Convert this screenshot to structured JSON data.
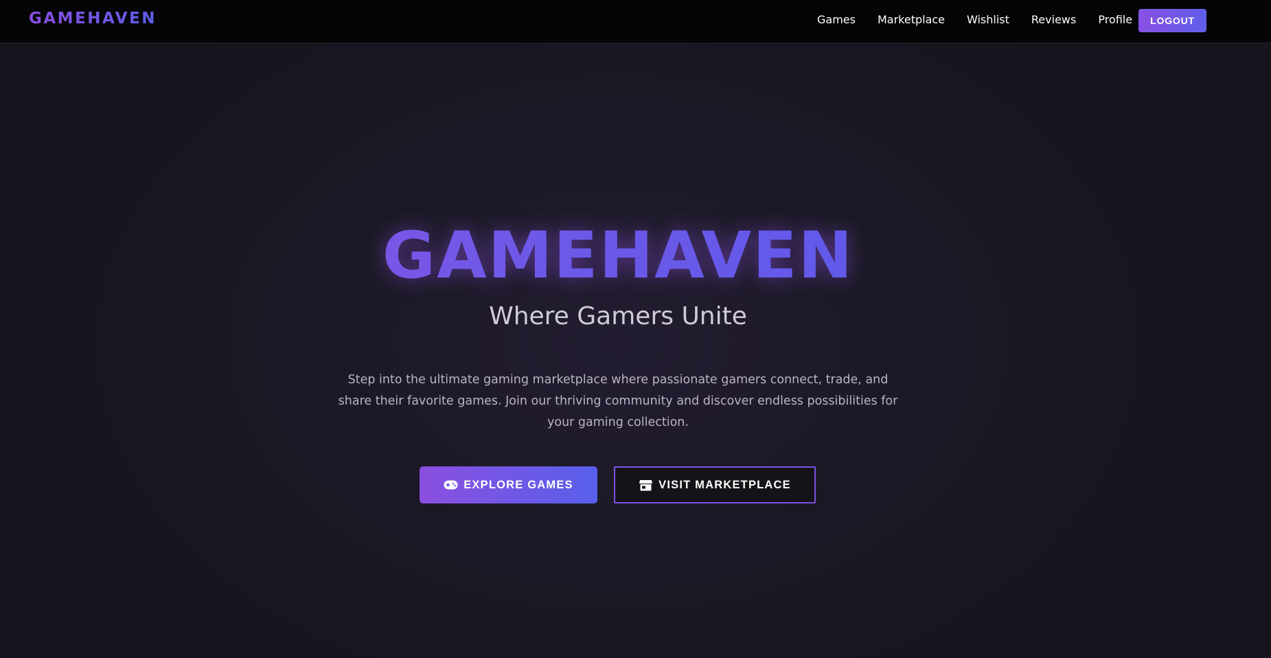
{
  "header": {
    "brand": "GAMEHAVEN",
    "nav": [
      {
        "label": "Games"
      },
      {
        "label": "Marketplace"
      },
      {
        "label": "Wishlist"
      },
      {
        "label": "Reviews"
      },
      {
        "label": "Profile"
      }
    ],
    "logout_label": "LOGOUT"
  },
  "hero": {
    "title": "GAMEHAVEN",
    "subtitle": "Where Gamers Unite",
    "description": "Step into the ultimate gaming marketplace where passionate gamers connect, trade, and share their favorite games. Join our thriving community and discover endless possibilities for your gaming collection.",
    "primary_button": {
      "label": "EXPLORE GAMES",
      "icon": "gamepad-icon"
    },
    "secondary_button": {
      "label": "VISIT MARKETPLACE",
      "icon": "store-icon"
    }
  },
  "colors": {
    "accent_purple": "#8b4fe0",
    "accent_blue": "#5860eb",
    "background": "#16151d",
    "header_background": "#050507",
    "text_muted": "#b9b5c4"
  }
}
